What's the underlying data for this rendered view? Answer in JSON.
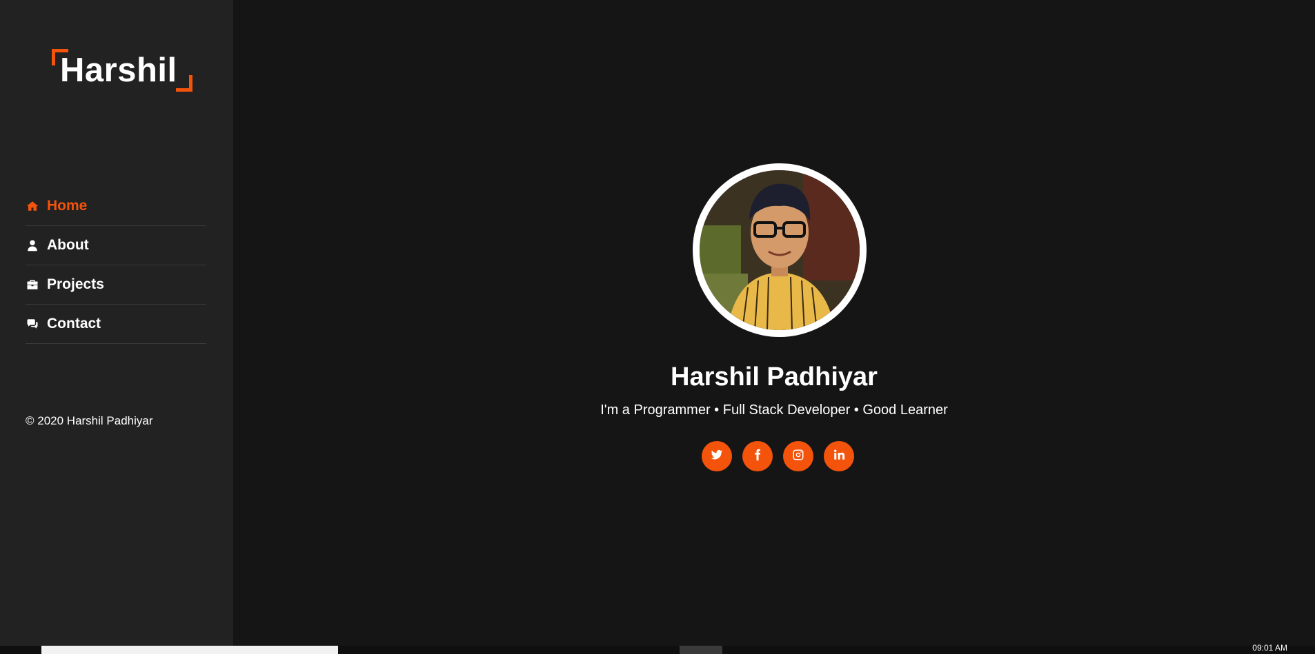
{
  "brand": {
    "logo_text": "Harshil",
    "accent_color": "#f4530b"
  },
  "sidebar": {
    "nav": [
      {
        "label": "Home",
        "icon": "home-icon",
        "active": true
      },
      {
        "label": "About",
        "icon": "user-icon",
        "active": false
      },
      {
        "label": "Projects",
        "icon": "briefcase-icon",
        "active": false
      },
      {
        "label": "Contact",
        "icon": "comments-icon",
        "active": false
      }
    ],
    "copyright": "© 2020 Harshil Padhiyar"
  },
  "hero": {
    "avatar": "profile-photo",
    "name": "Harshil Padhiyar",
    "tagline": "I'm a Programmer • Full Stack Developer • Good Learner",
    "socials": [
      {
        "icon": "twitter-icon"
      },
      {
        "icon": "facebook-icon"
      },
      {
        "icon": "instagram-icon"
      },
      {
        "icon": "linkedin-icon"
      }
    ]
  },
  "taskbar": {
    "clock": "09:01 AM"
  }
}
